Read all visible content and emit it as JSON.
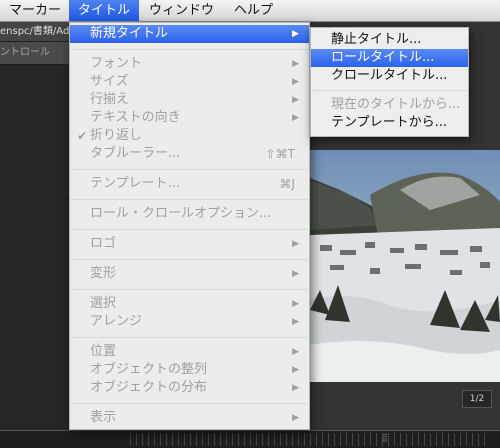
{
  "menubar": {
    "items": [
      {
        "label": "マーカー"
      },
      {
        "label": "タイトル"
      },
      {
        "label": "ウィンドウ"
      },
      {
        "label": "ヘルプ"
      }
    ]
  },
  "background": {
    "path_text": "enspc/書類/Ad",
    "panel_tab": "ントロール",
    "counter": "1/2"
  },
  "title_menu": {
    "new_title": "新規タイトル",
    "font": "フォント",
    "size": "サイズ",
    "align": "行揃え",
    "text_direction": "テキストの向き",
    "check_mark": "✔",
    "wrap": "折り返し",
    "tab_ruler": "タブルーラー...",
    "tab_ruler_shortcut": "⇧⌘T",
    "template": "テンプレート...",
    "template_shortcut": "⌘J",
    "roll_crawl_options": "ロール・クロールオプション...",
    "logo": "ロゴ",
    "transform": "変形",
    "select": "選択",
    "arrange": "アレンジ",
    "position": "位置",
    "align_objects": "オブジェクトの整列",
    "distribute_objects": "オブジェクトの分布",
    "view": "表示"
  },
  "new_title_submenu": {
    "still": "静止タイトル...",
    "roll": "ロールタイトル...",
    "crawl": "クロールタイトル...",
    "from_current": "現在のタイトルから...",
    "from_template": "テンプレートから..."
  },
  "colors": {
    "highlight": "#2b62ea",
    "disabled_text": "#a0a0a0"
  }
}
